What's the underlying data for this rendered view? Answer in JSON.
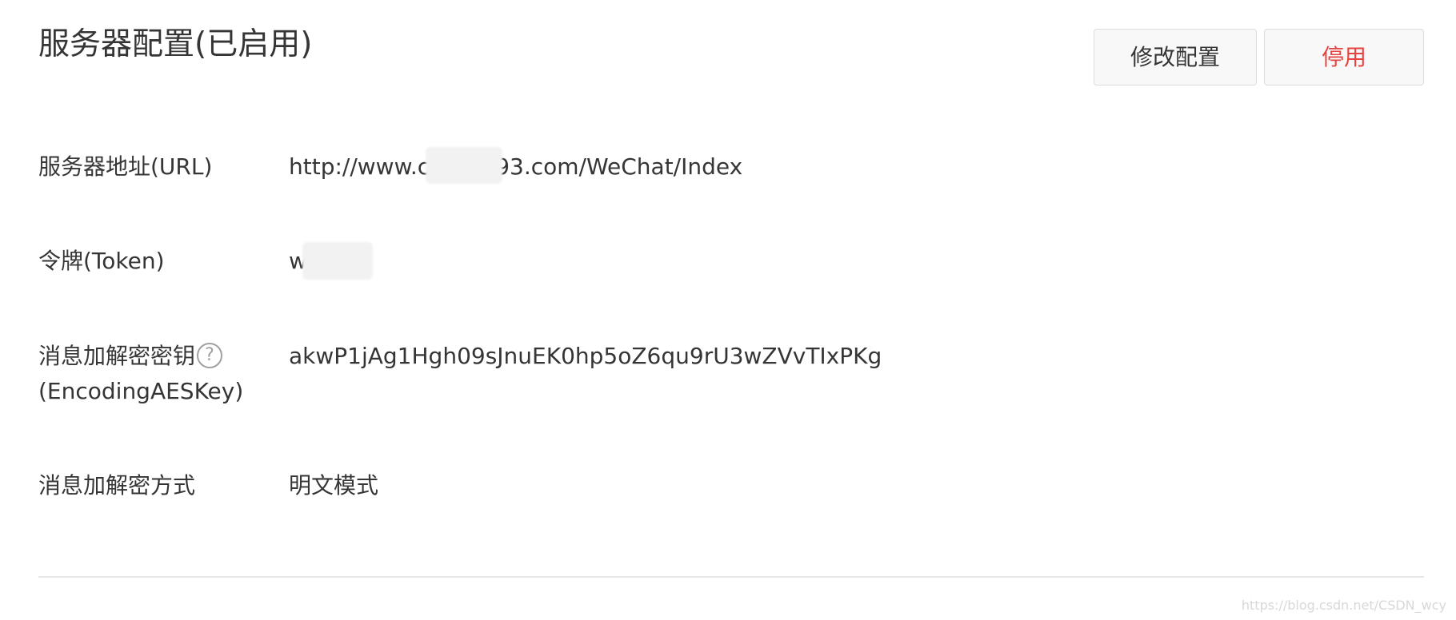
{
  "page": {
    "title": "服务器配置(已启用)",
    "buttons": {
      "edit_label": "修改配置",
      "disable_label": "停用"
    },
    "colors": {
      "text": "#353535",
      "danger": "#e64340",
      "border": "#dcdcdc",
      "button_bg": "#f8f8f8",
      "divider": "#e7e7e7"
    }
  },
  "config": {
    "url": {
      "label": "服务器地址(URL)",
      "value_prefix": "http://www.c",
      "value_suffix": "93.com/WeChat/Index"
    },
    "token": {
      "label": "令牌(Token)",
      "value_prefix": "w"
    },
    "aes_key": {
      "label_line1": "消息加解密密钥",
      "label_line2": "(EncodingAESKey)",
      "help_icon": "question-circle-icon",
      "help_glyph": "?",
      "value": "akwP1jAg1Hgh09sJnuEK0hp5oZ6qu9rU3wZVvTIxPKg"
    },
    "encryption_mode": {
      "label": "消息加解密方式",
      "value": "明文模式"
    }
  },
  "watermark": "https://blog.csdn.net/CSDN_wcy"
}
